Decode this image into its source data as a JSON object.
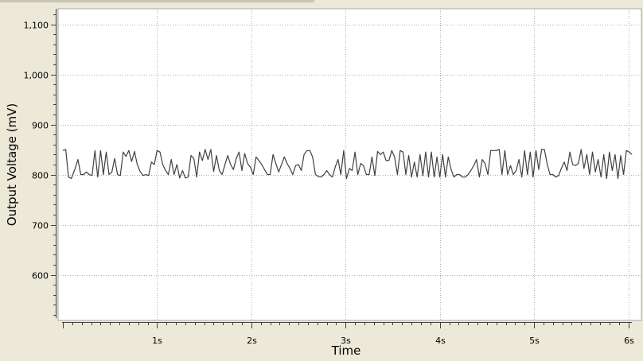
{
  "chart_data": {
    "type": "line",
    "title": "",
    "xlabel": "Time",
    "ylabel": "Output Voltage (mV)",
    "xlim": [
      -0.015,
      6.05
    ],
    "ylim": [
      510,
      1130
    ],
    "x_ticks": [
      {
        "value": 1,
        "label": "1s"
      },
      {
        "value": 2,
        "label": "2s"
      },
      {
        "value": 3,
        "label": "3s"
      },
      {
        "value": 4,
        "label": "4s"
      },
      {
        "value": 5,
        "label": "5s"
      },
      {
        "value": 6,
        "label": "6s"
      }
    ],
    "y_ticks": [
      {
        "value": 600,
        "label": "600"
      },
      {
        "value": 700,
        "label": "700"
      },
      {
        "value": 800,
        "label": "800"
      },
      {
        "value": 900,
        "label": "900"
      },
      {
        "value": 1000,
        "label": "1,000"
      },
      {
        "value": 1100,
        "label": "1,100"
      }
    ],
    "grid": true,
    "line_color": "#404040",
    "series": [
      {
        "values": [
          [
            0.0,
            848
          ],
          [
            0.03,
            850
          ],
          [
            0.06,
            795
          ],
          [
            0.09,
            792
          ],
          [
            0.13,
            812
          ],
          [
            0.16,
            830
          ],
          [
            0.19,
            800
          ],
          [
            0.22,
            800
          ],
          [
            0.25,
            805
          ],
          [
            0.28,
            800
          ],
          [
            0.31,
            798
          ],
          [
            0.34,
            848
          ],
          [
            0.37,
            795
          ],
          [
            0.4,
            848
          ],
          [
            0.43,
            800
          ],
          [
            0.46,
            845
          ],
          [
            0.49,
            800
          ],
          [
            0.52,
            805
          ],
          [
            0.55,
            832
          ],
          [
            0.58,
            800
          ],
          [
            0.61,
            798
          ],
          [
            0.64,
            845
          ],
          [
            0.67,
            836
          ],
          [
            0.7,
            848
          ],
          [
            0.73,
            826
          ],
          [
            0.76,
            846
          ],
          [
            0.79,
            820
          ],
          [
            0.82,
            806
          ],
          [
            0.85,
            798
          ],
          [
            0.88,
            800
          ],
          [
            0.91,
            798
          ],
          [
            0.94,
            825
          ],
          [
            0.97,
            820
          ],
          [
            1.0,
            848
          ],
          [
            1.03,
            845
          ],
          [
            1.06,
            820
          ],
          [
            1.09,
            808
          ],
          [
            1.12,
            800
          ],
          [
            1.15,
            830
          ],
          [
            1.18,
            800
          ],
          [
            1.21,
            820
          ],
          [
            1.24,
            793
          ],
          [
            1.27,
            808
          ],
          [
            1.3,
            793
          ],
          [
            1.33,
            795
          ],
          [
            1.36,
            838
          ],
          [
            1.39,
            832
          ],
          [
            1.42,
            795
          ],
          [
            1.45,
            845
          ],
          [
            1.48,
            828
          ],
          [
            1.51,
            850
          ],
          [
            1.54,
            830
          ],
          [
            1.57,
            850
          ],
          [
            1.6,
            806
          ],
          [
            1.63,
            838
          ],
          [
            1.66,
            808
          ],
          [
            1.69,
            800
          ],
          [
            1.72,
            820
          ],
          [
            1.75,
            838
          ],
          [
            1.78,
            820
          ],
          [
            1.81,
            810
          ],
          [
            1.84,
            832
          ],
          [
            1.87,
            845
          ],
          [
            1.9,
            808
          ],
          [
            1.93,
            842
          ],
          [
            1.96,
            822
          ],
          [
            1.99,
            815
          ],
          [
            2.02,
            800
          ],
          [
            2.05,
            835
          ],
          [
            2.08,
            828
          ],
          [
            2.11,
            820
          ],
          [
            2.14,
            810
          ],
          [
            2.17,
            800
          ],
          [
            2.2,
            800
          ],
          [
            2.23,
            840
          ],
          [
            2.26,
            822
          ],
          [
            2.29,
            805
          ],
          [
            2.32,
            820
          ],
          [
            2.35,
            835
          ],
          [
            2.38,
            822
          ],
          [
            2.41,
            812
          ],
          [
            2.44,
            800
          ],
          [
            2.47,
            818
          ],
          [
            2.5,
            820
          ],
          [
            2.53,
            808
          ],
          [
            2.56,
            840
          ],
          [
            2.59,
            848
          ],
          [
            2.62,
            848
          ],
          [
            2.65,
            835
          ],
          [
            2.68,
            800
          ],
          [
            2.71,
            796
          ],
          [
            2.74,
            795
          ],
          [
            2.77,
            800
          ],
          [
            2.8,
            808
          ],
          [
            2.83,
            800
          ],
          [
            2.86,
            795
          ],
          [
            2.89,
            815
          ],
          [
            2.92,
            830
          ],
          [
            2.95,
            800
          ],
          [
            2.98,
            848
          ],
          [
            3.01,
            792
          ],
          [
            3.04,
            812
          ],
          [
            3.07,
            808
          ],
          [
            3.1,
            845
          ],
          [
            3.13,
            800
          ],
          [
            3.16,
            822
          ],
          [
            3.19,
            818
          ],
          [
            3.22,
            800
          ],
          [
            3.25,
            800
          ],
          [
            3.28,
            835
          ],
          [
            3.31,
            798
          ],
          [
            3.34,
            846
          ],
          [
            3.37,
            840
          ],
          [
            3.4,
            845
          ],
          [
            3.43,
            828
          ],
          [
            3.46,
            828
          ],
          [
            3.49,
            848
          ],
          [
            3.52,
            835
          ],
          [
            3.55,
            800
          ],
          [
            3.58,
            848
          ],
          [
            3.61,
            845
          ],
          [
            3.64,
            800
          ],
          [
            3.67,
            838
          ],
          [
            3.7,
            795
          ],
          [
            3.73,
            825
          ],
          [
            3.76,
            795
          ],
          [
            3.79,
            840
          ],
          [
            3.82,
            798
          ],
          [
            3.85,
            845
          ],
          [
            3.88,
            795
          ],
          [
            3.91,
            845
          ],
          [
            3.94,
            795
          ],
          [
            3.97,
            835
          ],
          [
            4.0,
            795
          ],
          [
            4.03,
            840
          ],
          [
            4.06,
            795
          ],
          [
            4.09,
            835
          ],
          [
            4.12,
            810
          ],
          [
            4.15,
            795
          ],
          [
            4.18,
            800
          ],
          [
            4.21,
            800
          ],
          [
            4.24,
            795
          ],
          [
            4.27,
            795
          ],
          [
            4.3,
            800
          ],
          [
            4.33,
            808
          ],
          [
            4.36,
            818
          ],
          [
            4.39,
            830
          ],
          [
            4.42,
            795
          ],
          [
            4.45,
            830
          ],
          [
            4.48,
            822
          ],
          [
            4.51,
            800
          ],
          [
            4.54,
            848
          ],
          [
            4.57,
            848
          ],
          [
            4.6,
            848
          ],
          [
            4.63,
            850
          ],
          [
            4.66,
            800
          ],
          [
            4.69,
            848
          ],
          [
            4.72,
            800
          ],
          [
            4.75,
            818
          ],
          [
            4.78,
            800
          ],
          [
            4.81,
            808
          ],
          [
            4.84,
            830
          ],
          [
            4.87,
            795
          ],
          [
            4.9,
            848
          ],
          [
            4.93,
            800
          ],
          [
            4.96,
            845
          ],
          [
            4.99,
            795
          ],
          [
            5.02,
            848
          ],
          [
            5.05,
            810
          ],
          [
            5.08,
            850
          ],
          [
            5.11,
            850
          ],
          [
            5.14,
            820
          ],
          [
            5.17,
            800
          ],
          [
            5.2,
            800
          ],
          [
            5.23,
            795
          ],
          [
            5.26,
            798
          ],
          [
            5.29,
            812
          ],
          [
            5.32,
            825
          ],
          [
            5.35,
            808
          ],
          [
            5.38,
            845
          ],
          [
            5.41,
            820
          ],
          [
            5.44,
            818
          ],
          [
            5.47,
            822
          ],
          [
            5.5,
            850
          ],
          [
            5.53,
            812
          ],
          [
            5.56,
            840
          ],
          [
            5.59,
            800
          ],
          [
            5.62,
            845
          ],
          [
            5.65,
            805
          ],
          [
            5.68,
            830
          ],
          [
            5.71,
            795
          ],
          [
            5.74,
            840
          ],
          [
            5.77,
            792
          ],
          [
            5.8,
            845
          ],
          [
            5.83,
            808
          ],
          [
            5.86,
            840
          ],
          [
            5.89,
            792
          ],
          [
            5.92,
            838
          ],
          [
            5.95,
            800
          ],
          [
            5.98,
            848
          ],
          [
            6.01,
            845
          ],
          [
            6.04,
            840
          ]
        ]
      }
    ]
  }
}
